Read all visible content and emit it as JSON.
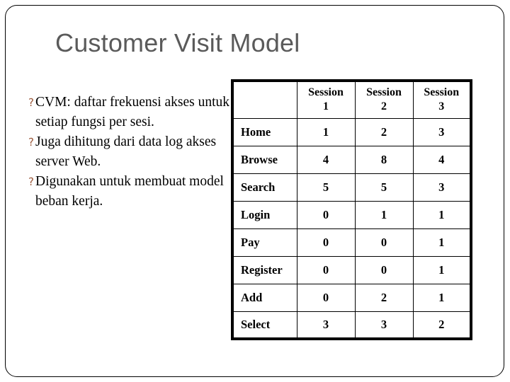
{
  "slide": {
    "title": "Customer Visit Model",
    "title_color": "#5a5a5a",
    "background": "#ffffff",
    "frame_color": "#000000"
  },
  "body": {
    "bullet_glyph": "؟",
    "bullet_color": "#9C5A3C",
    "bullets": [
      "CVM: daftar frekuensi akses untuk setiap fungsi per sesi.",
      "Juga dihitung dari data log akses server Web.",
      "Digunakan untuk membuat model beban kerja."
    ]
  },
  "table": {
    "corner_label": "",
    "session_label": "Session",
    "columns": [
      {
        "label": "Session",
        "number": "1"
      },
      {
        "label": "Session",
        "number": "2"
      },
      {
        "label": "Session",
        "number": "3"
      }
    ],
    "rows": [
      {
        "label": "Home",
        "values": [
          "1",
          "2",
          "3"
        ]
      },
      {
        "label": "Browse",
        "values": [
          "4",
          "8",
          "4"
        ]
      },
      {
        "label": "Search",
        "values": [
          "5",
          "5",
          "3"
        ]
      },
      {
        "label": "Login",
        "values": [
          "0",
          "1",
          "1"
        ]
      },
      {
        "label": "Pay",
        "values": [
          "0",
          "0",
          "1"
        ]
      },
      {
        "label": "Register",
        "values": [
          "0",
          "0",
          "1"
        ]
      },
      {
        "label": "Add",
        "values": [
          "0",
          "2",
          "1"
        ]
      },
      {
        "label": "Select",
        "values": [
          "3",
          "3",
          "2"
        ]
      }
    ]
  }
}
